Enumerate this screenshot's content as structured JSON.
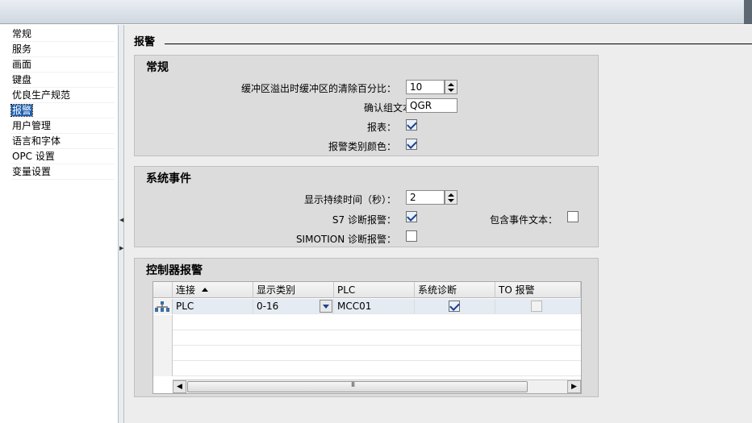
{
  "nav": {
    "items": [
      {
        "label": "常规",
        "selected": false
      },
      {
        "label": "服务",
        "selected": false
      },
      {
        "label": "画面",
        "selected": false
      },
      {
        "label": "键盘",
        "selected": false
      },
      {
        "label": "优良生产规范",
        "selected": false
      },
      {
        "label": "报警",
        "selected": true
      },
      {
        "label": "用户管理",
        "selected": false
      },
      {
        "label": "语言和字体",
        "selected": false
      },
      {
        "label": "OPC 设置",
        "selected": false
      },
      {
        "label": "变量设置",
        "selected": false
      }
    ]
  },
  "page": {
    "title": "报警"
  },
  "general": {
    "title": "常规",
    "buffer_label": "缓冲区溢出时缓冲区的清除百分比：",
    "buffer_value": "10",
    "ack_group_label": "确认组文本:",
    "ack_group_value": "QGR",
    "report_label": "报表：",
    "report_checked": true,
    "class_color_label": "报警类别颜色：",
    "class_color_checked": true
  },
  "system_events": {
    "title": "系统事件",
    "duration_label": "显示持续时间（秒）：",
    "duration_value": "2",
    "s7_label": "S7 诊断报警：",
    "s7_checked": true,
    "include_text_label": "包含事件文本：",
    "include_text_checked": false,
    "simotion_label": "SIMOTION 诊断报警：",
    "simotion_checked": false
  },
  "controller_alarms": {
    "title": "控制器报警",
    "columns": [
      "连接",
      "显示类别",
      "PLC",
      "系统诊断",
      "TO 报警"
    ],
    "rows": [
      {
        "connection": "PLC",
        "display_class": "0-16",
        "plc": "MCC01",
        "system_diag": true,
        "to_alarm": false
      }
    ]
  },
  "colors": {
    "selection": "#1d5fb0",
    "panel": "#dcdcdc",
    "background": "#ededed"
  }
}
